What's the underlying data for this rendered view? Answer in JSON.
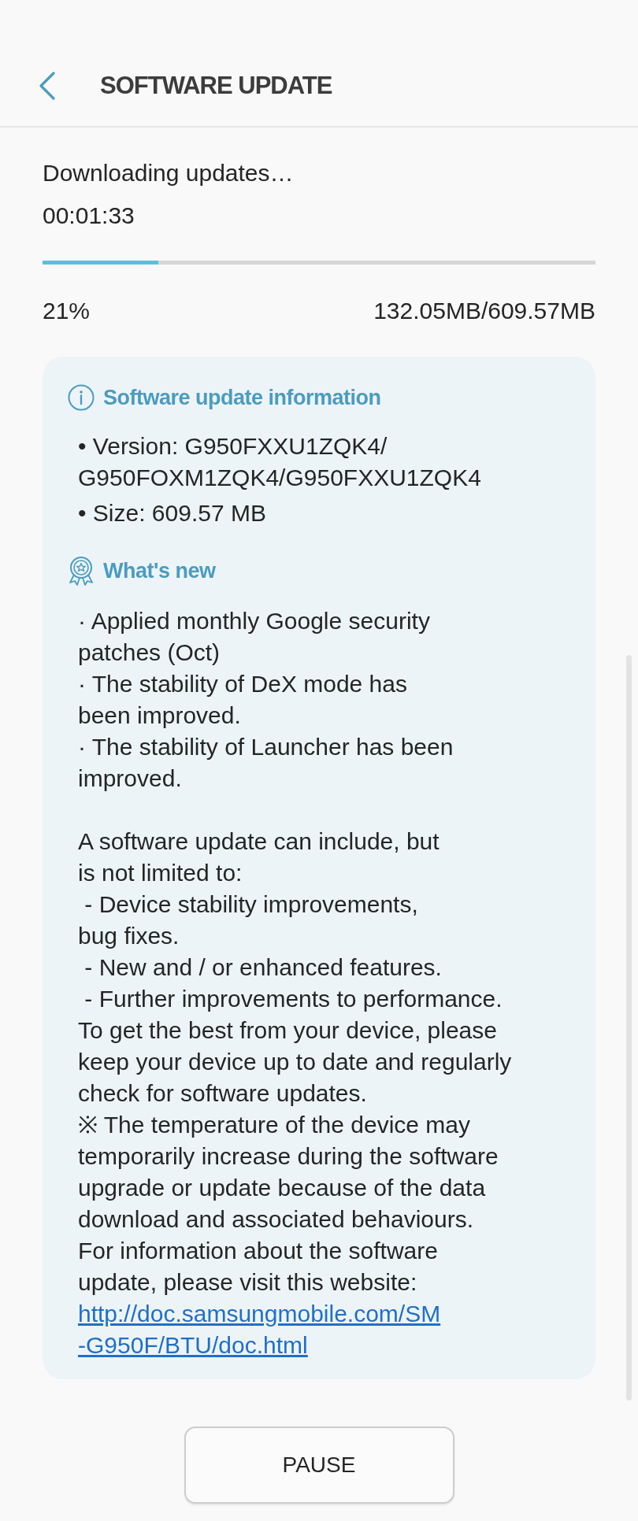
{
  "header": {
    "title": "SOFTWARE UPDATE"
  },
  "download": {
    "status": "Downloading updates…",
    "elapsed": "00:01:33",
    "level": 0.21,
    "percent": "21%",
    "amount": "132.05MB/609.57MB"
  },
  "info_card": {
    "sections": [
      {
        "kind": "info",
        "heading": "Software update information",
        "lines": [
          "• Version: G950FXXU1ZQK4/\nG950FOXM1ZQK4/G950FXXU1ZQK4",
          "• Size: 609.57 MB"
        ]
      },
      {
        "kind": "whats_new",
        "heading": "What's new",
        "lines": [
          "· Applied monthly Google security\npatches (Oct)",
          "· The stability of DeX mode has\nbeen improved.",
          "· The stability of Launcher has been\nimproved."
        ],
        "notes": [
          "A software update can include, but\nis not limited to:",
          " - Device stability improvements,\nbug fixes.",
          " - New and / or enhanced features.",
          " - Further improvements to performance.",
          "To get the best from your device, please\nkeep your device up to date and regularly\ncheck for software updates.",
          "※ The temperature of the device may\ntemporarily increase during the software\nupgrade or update because of the data\ndownload and associated behaviours.",
          "For information about the software\nupdate, please visit this website:"
        ],
        "link": "http://doc.samsungmobile.com/SM\n-G950F/BTU/doc.html"
      }
    ]
  },
  "pause_button": {
    "label": "PAUSE"
  }
}
